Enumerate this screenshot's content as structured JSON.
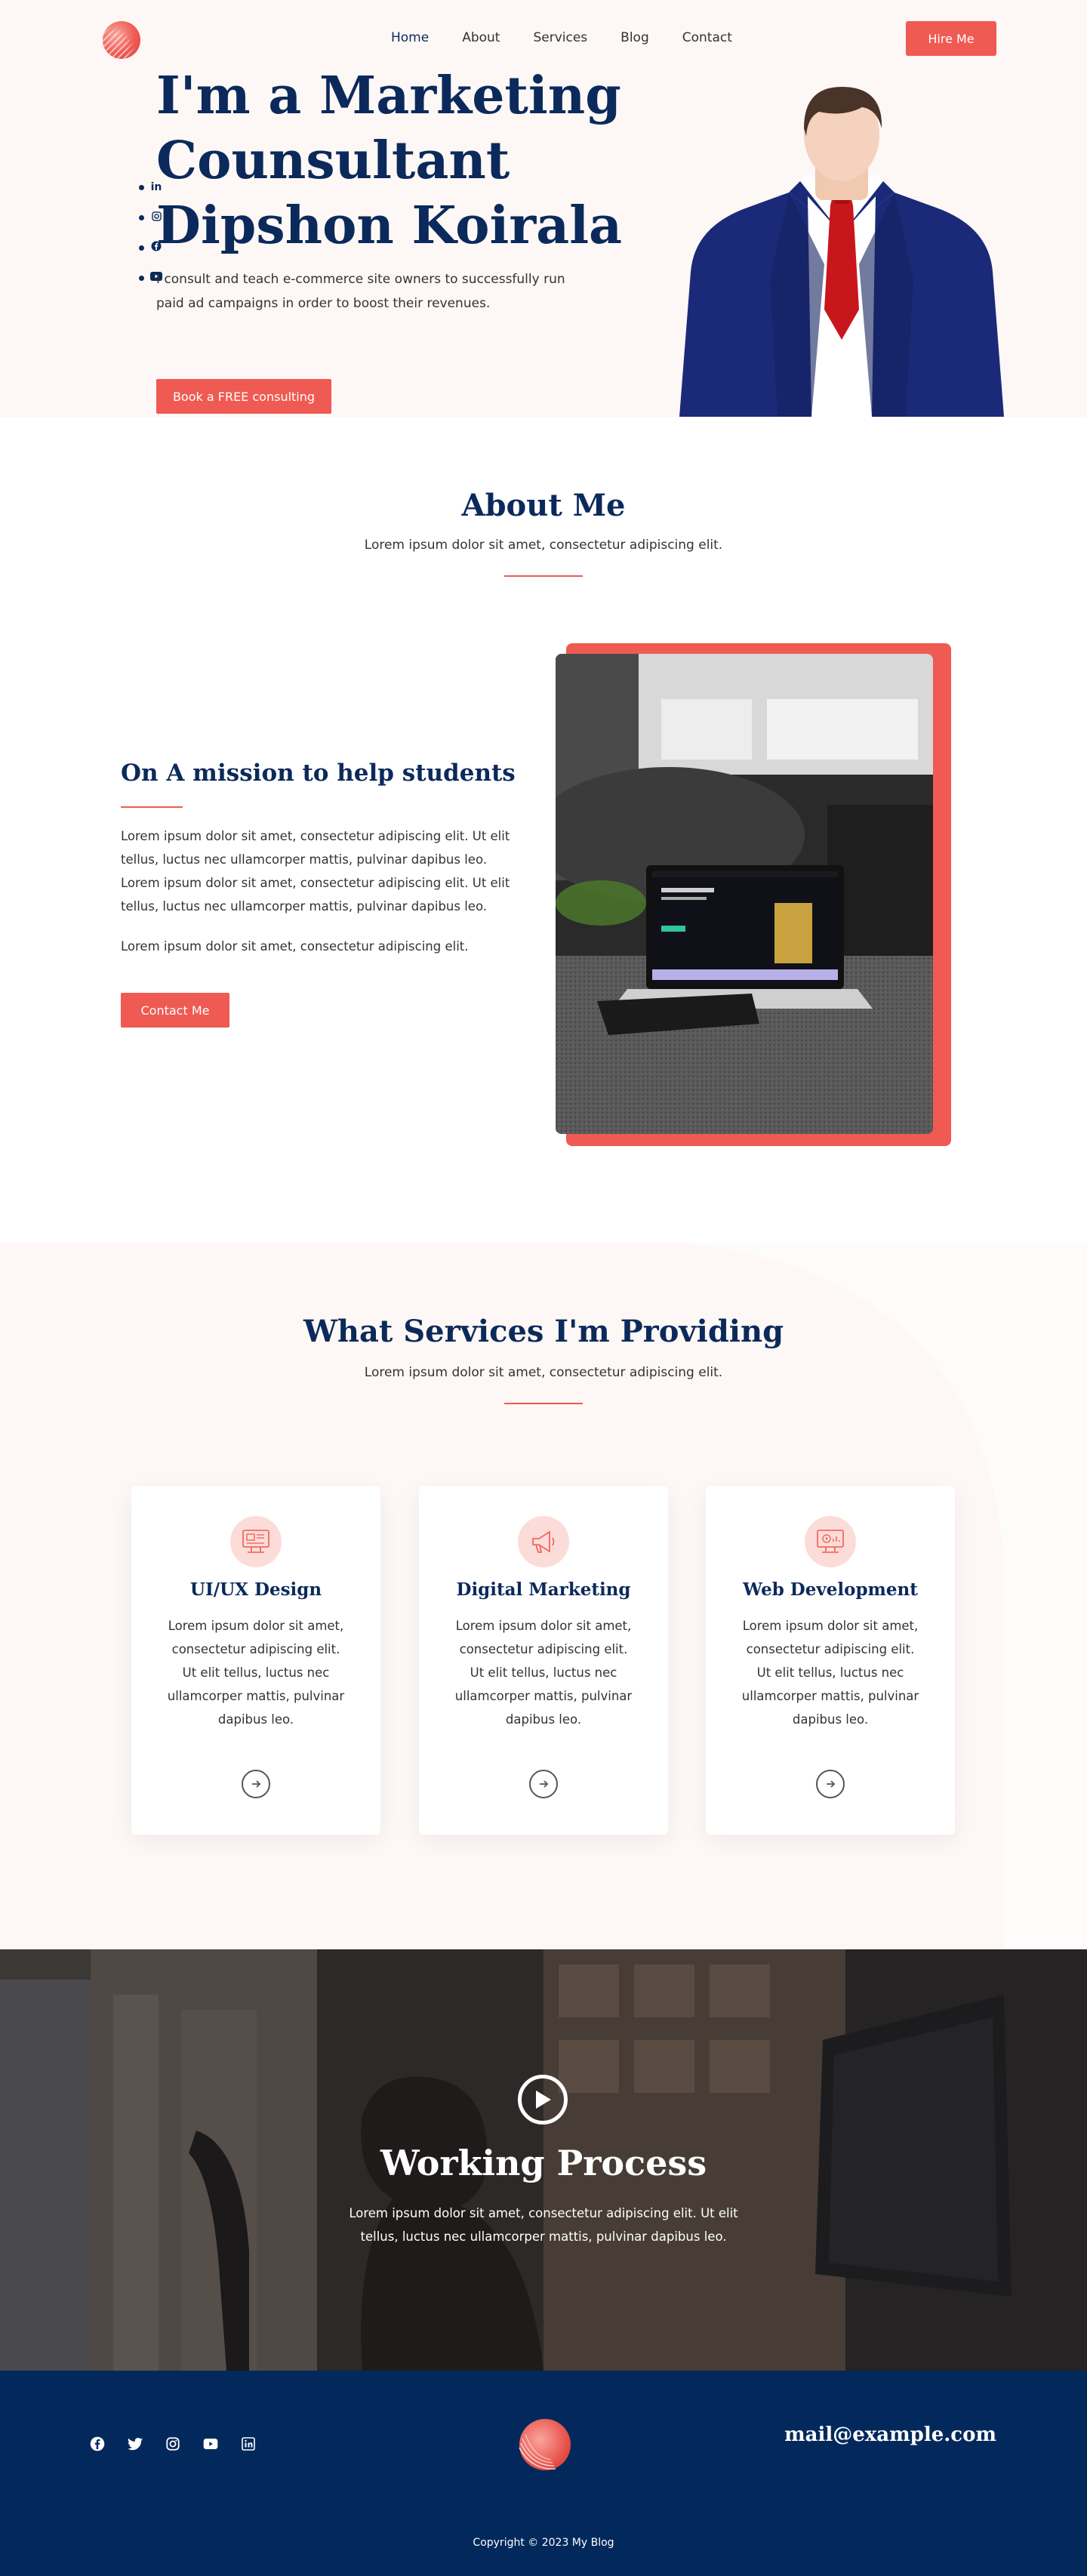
{
  "header": {
    "nav": [
      "Home",
      "About",
      "Services",
      "Blog",
      "Contact"
    ],
    "hire_label": "Hire Me"
  },
  "hero": {
    "title_line1": "I'm a Marketing",
    "title_line2": "Counsultant",
    "title_line3": "Dipshon Koirala",
    "text": "I consult and teach e-commerce site owners to successfully run paid ad campaigns in order to boost their revenues.",
    "cta_label": "Book a FREE consulting",
    "social_icons": [
      "linkedin-icon",
      "instagram-icon",
      "facebook-icon",
      "youtube-icon"
    ]
  },
  "about": {
    "title": "About Me",
    "subtitle": "Lorem ipsum dolor sit amet, consectetur adipiscing elit.",
    "mission_title": "On A mission to help students",
    "p1": "Lorem ipsum dolor sit amet, consectetur adipiscing elit. Ut elit tellus, luctus nec ullamcorper mattis, pulvinar dapibus leo. Lorem ipsum dolor sit amet, consectetur adipiscing elit. Ut elit tellus, luctus nec ullamcorper mattis, pulvinar dapibus leo.",
    "p2": "Lorem ipsum dolor sit amet, consectetur adipiscing elit.",
    "contact_label": "Contact Me"
  },
  "services": {
    "title": "What Services I'm Providing",
    "subtitle": "Lorem ipsum dolor sit amet, consectetur adipiscing elit.",
    "cards": [
      {
        "title": "UI/UX Design",
        "text": "Lorem ipsum dolor sit amet, consectetur adipiscing elit. Ut elit tellus, luctus nec ullamcorper mattis, pulvinar dapibus leo."
      },
      {
        "title": "Digital Marketing",
        "text": "Lorem ipsum dolor sit amet, consectetur adipiscing elit. Ut elit tellus, luctus nec ullamcorper mattis, pulvinar dapibus leo."
      },
      {
        "title": "Web Development",
        "text": "Lorem ipsum dolor sit amet, consectetur adipiscing elit. Ut elit tellus, luctus nec ullamcorper mattis, pulvinar dapibus leo."
      }
    ]
  },
  "work": {
    "title": "Working Process",
    "text": "Lorem ipsum dolor sit amet, consectetur adipiscing elit. Ut elit tellus, luctus nec ullamcorper mattis, pulvinar dapibus leo."
  },
  "footer": {
    "email": "mail@example.com",
    "copyright": "Copyright © 2023 My Blog",
    "social_icons": [
      "facebook-icon",
      "twitter-icon",
      "instagram-icon",
      "youtube-icon",
      "linkedin-icon"
    ]
  },
  "colors": {
    "accent": "#ef5a52",
    "navy": "#0b2a5b",
    "footer": "#03295c",
    "hero_bg": "#fdf7f6"
  }
}
